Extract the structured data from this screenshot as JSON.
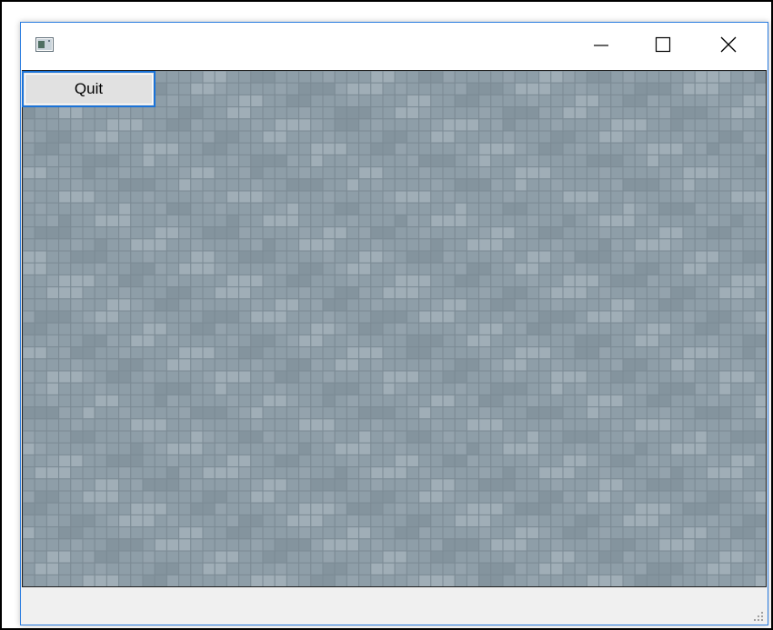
{
  "window": {
    "icon": "app-window-icon",
    "controls": {
      "minimize_icon": "minimize-icon",
      "maximize_icon": "maximize-icon",
      "close_icon": "close-icon"
    }
  },
  "toolbar": {
    "quit_label": "Quit"
  },
  "canvas": {
    "background": "#8e9ea8",
    "tile_light": "#a0aeb7",
    "tile_mid": "#94a3ad",
    "tile_dark": "#84949e",
    "grid_line": "#7c8b95"
  },
  "statusbar": {
    "grip_icon": "resize-grip-icon"
  },
  "colors": {
    "accent": "#1a73d9",
    "window_border": "#2b7de0"
  }
}
